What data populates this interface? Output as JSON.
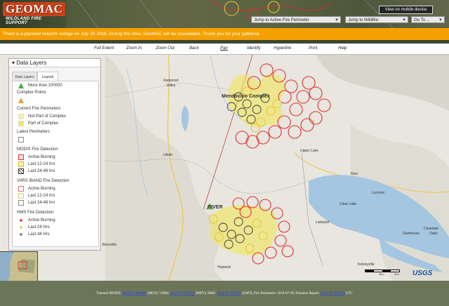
{
  "header": {
    "logo_main": "GEOMAC",
    "logo_sub": "WILDLAND FIRE SUPPORT",
    "select_perimeter": "Jump to Active Fire Perimeter",
    "select_wildfire": "Jump to Wildfire:",
    "select_goto": "Go To ...",
    "mobile_button": "View on mobile device"
  },
  "notice": {
    "text": "There is a planned network outage on July 28 2018. During this time, GeoMAC will be unavailable. Thank you for your patience."
  },
  "toolbar": {
    "items": [
      "Full Extent",
      "Zoom In",
      "Zoom Out",
      "Back",
      "Pan",
      "Identify",
      "Hyperlink",
      "Print",
      "Help"
    ]
  },
  "panel": {
    "title": "Data Layers",
    "tab_layers": "Data Layers",
    "tab_legend": "Legend",
    "legend": {
      "more_than": "More than 100000",
      "complex_points": "Complex Points",
      "current_perimeters": "Current Fire Perimeters",
      "not_part": "Not Part of Complex",
      "part": "Part of Complex",
      "latest_perimeters": "Latest Perimeters",
      "modis": "MODIS Fire Detection",
      "modis_active": "Active Burning",
      "modis_12": "Last 12-24 hrs",
      "modis_24": "Last 24-48 hrs",
      "viirs": "VIIRS IBAND Fire Detection",
      "viirs_active": "Active Burning",
      "viirs_12": "Last 12-24 hrs",
      "viirs_24": "Last 24-48 hrs",
      "hms": "HMS Fire Detection",
      "hms_active": "Active Burning",
      "hms_24": "Last 24 Hrs",
      "hms_48": "Last 48 Hrs"
    }
  },
  "map": {
    "labels": {
      "mendocino": "Mendocino Complex",
      "river": "RIVER",
      "redwood": "Redwood",
      "valley": "Valley",
      "ukiah": "Ukiah",
      "upper_lake": "Upper Lake",
      "nice": "Nice",
      "lucerne": "Lucerne",
      "clear_lake": "Clear Lake",
      "lakeport": "Lakeport",
      "glenhaven": "Glenhaven",
      "clearlake_oaks": "Clearlake",
      "oaks": "Oaks",
      "kelseyville": "Kelseyville",
      "hopland": "Hopland",
      "boonville": "Boonville"
    },
    "usgs": "USGS",
    "scale_km": "3km",
    "scale_mi": "2mi"
  },
  "footer": {
    "thermal_prefix": "Thermal MODIS:",
    "thermal_modis_date": "2018-07-30 4002",
    "viirs_prefix": "(MDT); VIIRS:",
    "viirs_date": "2018-07-30 3758",
    "hms_prefix": "(MDT); HMS:",
    "hms_date": "2018-07-26 7657",
    "perim_prefix": "(GMT); Fire Perimeters: 2018-07-29; Situation Report:",
    "sitrep_date": "2018-07-30 1270",
    "suffix": "UTC"
  },
  "colors": {
    "notice_bg": "#f5a000",
    "modis_active": "#e03030",
    "perimeter_yellow": "#f2e65a",
    "accent": "#3a4fd0"
  }
}
